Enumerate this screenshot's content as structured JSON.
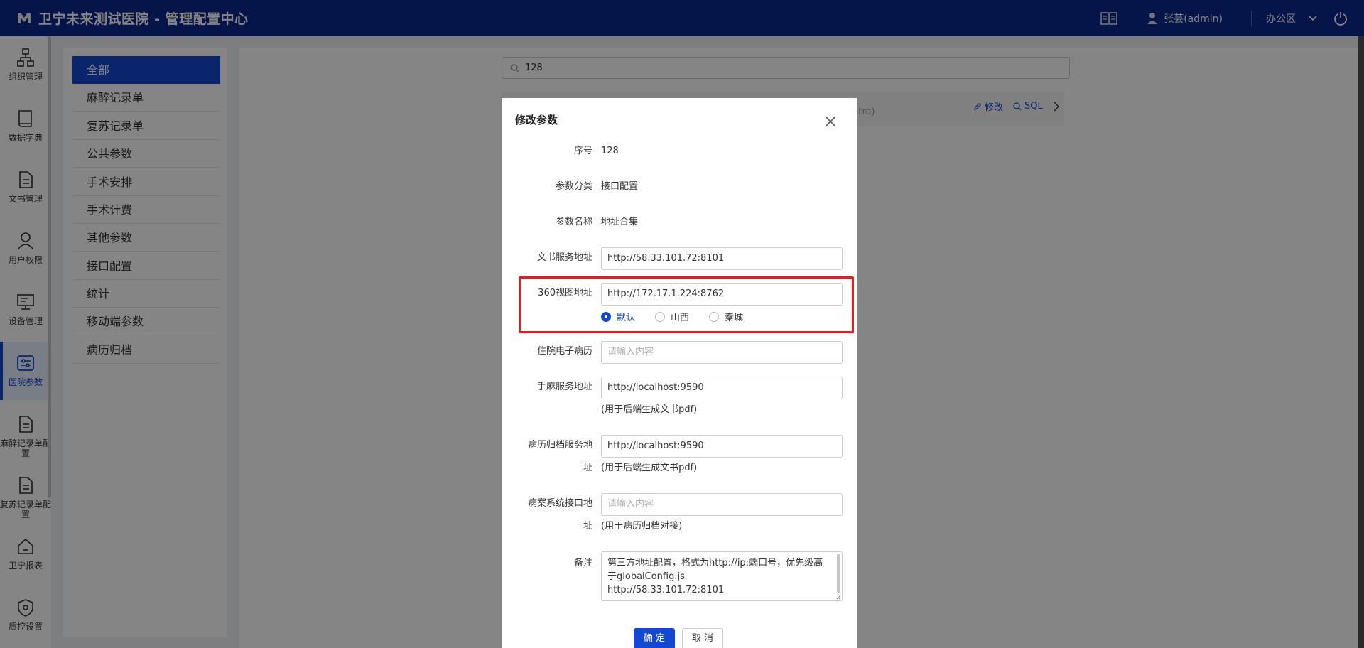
{
  "header": {
    "title": "卫宁未来测试医院 - 管理配置中心",
    "user": "张芸(admin)",
    "workspace": "办公区"
  },
  "sidenav": {
    "items": [
      {
        "label": "组织管理",
        "icon": "org-icon"
      },
      {
        "label": "数据字典",
        "icon": "book-icon"
      },
      {
        "label": "文书管理",
        "icon": "document-icon"
      },
      {
        "label": "用户权限",
        "icon": "user-icon"
      },
      {
        "label": "设备管理",
        "icon": "monitor-icon"
      },
      {
        "label": "医院参数",
        "icon": "params-icon",
        "active": true
      },
      {
        "label": "麻醉记录单配置",
        "icon": "document-icon"
      },
      {
        "label": "复苏记录单配置",
        "icon": "document-icon"
      },
      {
        "label": "卫宁报表",
        "icon": "home-icon"
      },
      {
        "label": "质控设置",
        "icon": "shield-icon"
      }
    ]
  },
  "categories": {
    "items": [
      "全部",
      "麻醉记录单",
      "复苏记录单",
      "公共参数",
      "手术安排",
      "手术计费",
      "其他参数",
      "接口配置",
      "统计",
      "移动端参数",
      "病历归档"
    ],
    "active_index": 0
  },
  "search": {
    "value": "128"
  },
  "card": {
    "edit": "修改",
    "sql": "SQL",
    "faint_text": "ntro)"
  },
  "dialog": {
    "title": "修改参数",
    "fields": {
      "seq_label": "序号",
      "seq_value": "128",
      "category_label": "参数分类",
      "category_value": "接口配置",
      "name_label": "参数名称",
      "name_value": "地址合集",
      "doc_service_label": "文书服务地址",
      "doc_service_value": "http://58.33.101.72:8101",
      "view360_label": "360视图地址",
      "view360_value": "http://172.17.1.224:8762",
      "inpatient_label": "住院电子病历",
      "inpatient_placeholder": "请输入内容",
      "anesthesia_label": "手麻服务地址",
      "anesthesia_value": "http://localhost:9590",
      "anesthesia_hint": "(用于后端生成文书pdf)",
      "archive_label_1": "病历归档服务地",
      "archive_label_2": "址",
      "archive_value": "http://localhost:9590",
      "archive_hint": "(用于后端生成文书pdf)",
      "case_label_1": "病案系统接口地",
      "case_label_2": "址",
      "case_placeholder": "请输入内容",
      "case_hint": "(用于病历归档对接)",
      "remark_label": "备注",
      "remark_line1": "第三方地址配置，格式为http://ip:端口号，优先级高",
      "remark_line2": "于globalConfig.js",
      "remark_line3": "http://58.33.101.72:8101"
    },
    "radios": [
      {
        "label": "默认",
        "selected": true
      },
      {
        "label": "山西",
        "selected": false
      },
      {
        "label": "秦城",
        "selected": false
      }
    ],
    "ok": "确 定",
    "cancel": "取 消"
  },
  "colors": {
    "header_bg": "#0a2a8c",
    "primary": "#1448d0",
    "highlight": "#e02020"
  }
}
